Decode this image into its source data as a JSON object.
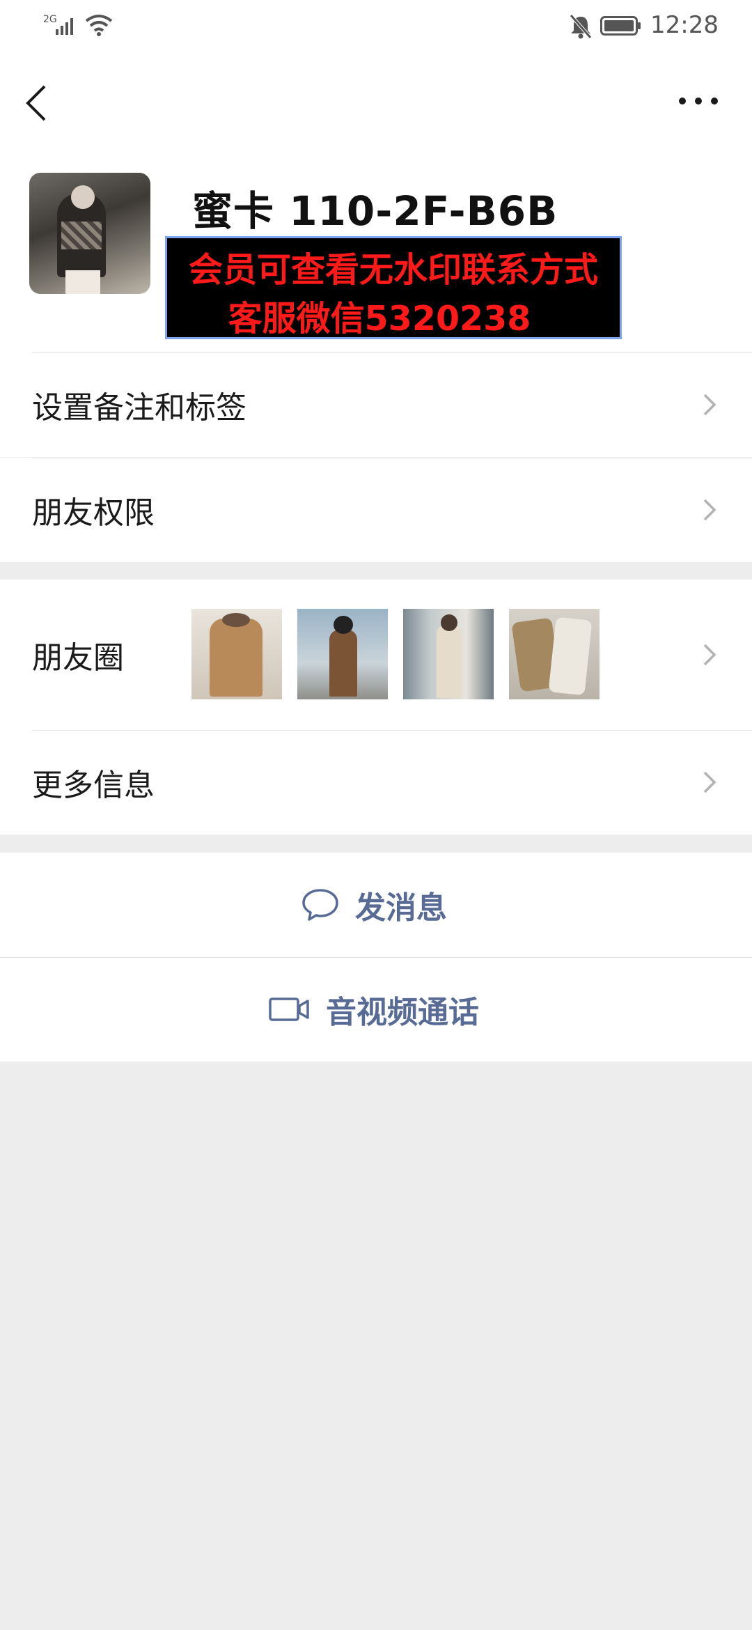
{
  "status_bar": {
    "network": "2G",
    "time": "12:28",
    "icons": [
      "signal-icon",
      "wifi-icon",
      "mute-bell-icon",
      "battery-icon"
    ]
  },
  "nav": {
    "back_icon": "chevron-left-icon",
    "more_icon": "more-dots-icon"
  },
  "profile": {
    "display_name": "蜜卡 110-2F-B6B",
    "watermark_line1": "会员可查看无水印联系方式",
    "watermark_line2": "客服微信5320238"
  },
  "rows": {
    "remark": "设置备注和标签",
    "permissions": "朋友权限",
    "moments": "朋友圈",
    "more_info": "更多信息"
  },
  "actions": {
    "send_message": "发消息",
    "video_call": "音视频通话"
  },
  "colors": {
    "link_blue": "#576b95",
    "background": "#ededed",
    "watermark_red": "#ff1a1a"
  }
}
